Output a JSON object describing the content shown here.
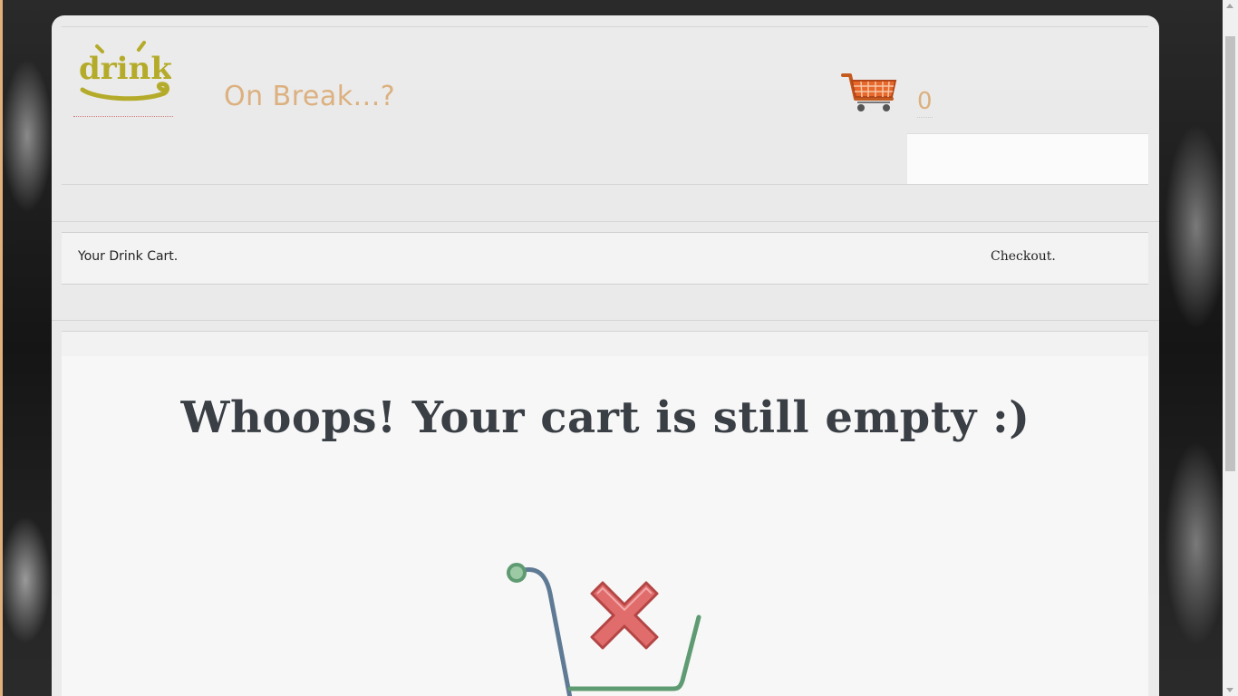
{
  "header": {
    "logo_text": "drinks",
    "tagline": "On Break...?",
    "cart_count": "0"
  },
  "nav": {
    "cart_label": "Your Drink Cart.",
    "checkout_label": "Checkout."
  },
  "main": {
    "empty_message": "Whoops! Your cart is still empty :)"
  },
  "icons": {
    "logo": "drinks-logo",
    "cart": "shopping-cart-icon",
    "empty_cart": "empty-cart-icon",
    "remove": "red-x-icon"
  },
  "colors": {
    "tagline": "#dcb07f",
    "logo": "#b5ab2a",
    "title": "#3a3f45",
    "x_mark": "#e06c6c",
    "cart_handle": "#5f7a94",
    "cart_basket": "#5f9b72"
  }
}
